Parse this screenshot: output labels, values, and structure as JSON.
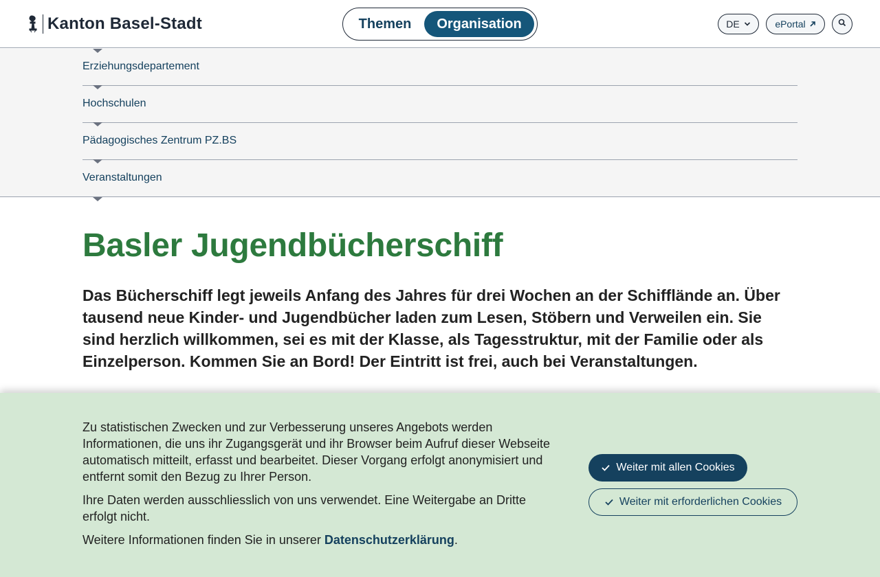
{
  "header": {
    "logo_text": "Kanton Basel-Stadt",
    "nav": {
      "themen": "Themen",
      "organisation": "Organisation"
    },
    "language": "DE",
    "eportal": "ePortal"
  },
  "breadcrumbs": [
    "Erziehungsdepartement",
    "Hochschulen",
    "Pädagogisches Zentrum PZ.BS",
    "Veranstaltungen"
  ],
  "main": {
    "title": "Basler Jugendbücherschiff",
    "lead": "Das Bücherschiff legt jeweils Anfang des Jahres für drei Wochen an der Schifflände an. Über tausend neue Kinder- und Jugendbücher laden zum Lesen, Stöbern und Verweilen ein. Sie sind herzlich willkommen, sei es mit der Klasse, als Tagesstruktur, mit der Familie oder als Einzelperson. Kommen Sie an Bord! Der Eintritt ist frei, auch bei Veranstaltungen."
  },
  "cookie": {
    "p1": "Zu statistischen Zwecken und zur Verbesserung unseres Angebots werden Informationen, die uns ihr Zugangsgerät und ihr Browser beim Aufruf dieser Webseite automatisch mitteilt, erfasst und bearbeitet. Dieser Vorgang erfolgt anonymisiert und entfernt somit den Bezug zu Ihrer Person.",
    "p2": "Ihre Daten werden ausschliesslich von uns verwendet. Eine Weitergabe an Dritte erfolgt nicht.",
    "p3_prefix": "Weitere Informationen finden Sie in unserer ",
    "p3_link": "Datenschutzerklärung",
    "p3_suffix": ".",
    "btn_all": "Weiter mit allen Cookies",
    "btn_required": "Weiter mit erforderlichen Cookies"
  },
  "colors": {
    "title_green": "#2d7a3e",
    "primary_blue": "#15415e",
    "active_nav": "#15567a",
    "banner_bg": "#d4e8d4"
  }
}
